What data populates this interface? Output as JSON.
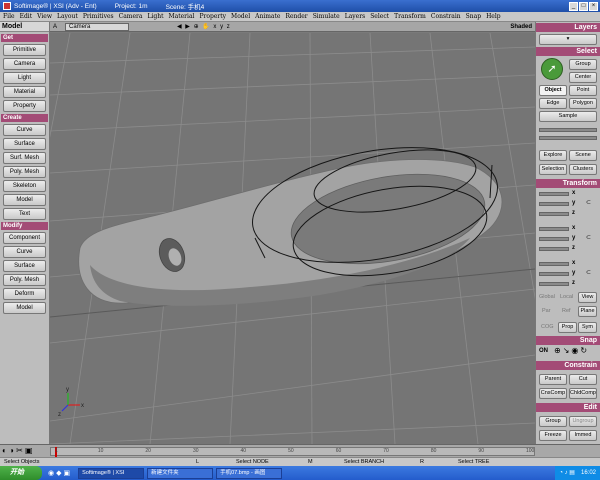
{
  "window": {
    "app_name": "Softimage® | XSI (Adv - Ent)",
    "project": "Project: 1m",
    "scene": "Scene: 手机4",
    "controls": [
      "_",
      "□",
      "×"
    ]
  },
  "menu": [
    "File",
    "Edit",
    "View",
    "Layout",
    "Primitives",
    "Camera",
    "Light",
    "Material",
    "Property",
    "Model",
    "Animate",
    "Render",
    "Simulate",
    "Layers",
    "Select",
    "Transform",
    "Constrain",
    "Snap",
    "Help"
  ],
  "left_panel": {
    "module": "Model",
    "sections": [
      {
        "title": "Get",
        "buttons": [
          "Primitive",
          "Camera",
          "Light",
          "Material",
          "Property"
        ]
      },
      {
        "title": "Create",
        "buttons": [
          "Curve",
          "Surface",
          "Surf. Mesh",
          "Poly. Mesh",
          "Skeleton",
          "Model",
          "Text"
        ]
      },
      {
        "title": "Modify",
        "buttons": [
          "Component",
          "Curve",
          "Surface",
          "Poly. Mesh",
          "Deform",
          "Model"
        ]
      }
    ]
  },
  "viewport": {
    "camera_label": "Camera",
    "shading": "Shaded",
    "header_icons": "◀ ▶  ⊕ ✋ x y z",
    "axis_labels": [
      "x",
      "y",
      "z"
    ],
    "colors": {
      "background": "#757575",
      "grid": "#8a8a8a",
      "object": "#9a9a9a",
      "curves": "#151515"
    }
  },
  "right_panel": {
    "layers_title": "Layers",
    "select_title": "Select",
    "select_buttons": {
      "group": "Group",
      "center": "Center",
      "object": "Object",
      "point": "Point",
      "edge": "Edge",
      "polygon": "Polygon",
      "sample": "Sample",
      "explore": "Explore",
      "scene": "Scene",
      "selection": "Selection",
      "clusters": "Clusters"
    },
    "transform_title": "Transform",
    "axes": [
      "x",
      "y",
      "z"
    ],
    "transform_modes": {
      "global": "Global",
      "local": "Local",
      "view": "View",
      "par": "Par",
      "ref": "Ref",
      "plane": "Plane",
      "cog": "COG",
      "prop": "Prop",
      "sym": "Sym"
    },
    "snap_title": "Snap",
    "snap_on": "ON",
    "constrain_title": "Constrain",
    "constrain_buttons": {
      "parent": "Parent",
      "cut": "Cut",
      "cnscomp": "CnsComp",
      "chldcomp": "ChldComp"
    },
    "edit_title": "Edit",
    "edit_buttons": {
      "group": "Group",
      "ungroup": "Ungroup",
      "freeze": "Freeze",
      "immed": "Immed"
    }
  },
  "timeline": {
    "ticks": [
      "1",
      "10",
      "20",
      "30",
      "40",
      "50",
      "60",
      "70",
      "80",
      "90",
      "100"
    ],
    "current_frame": 1,
    "frame_range": [
      1,
      100
    ]
  },
  "statusbar": {
    "select_objects": "Select Objects",
    "select_node": "Select NODE",
    "select_branch": "Select BRANCH",
    "select_tree": "Select TREE",
    "marks": [
      "L",
      "M",
      "R"
    ]
  },
  "taskbar": {
    "start": "开始",
    "tasks": [
      "Softimage® | XSI",
      "新建文件夹",
      "手机07.bmp - 画图"
    ],
    "clock": "16:02"
  }
}
